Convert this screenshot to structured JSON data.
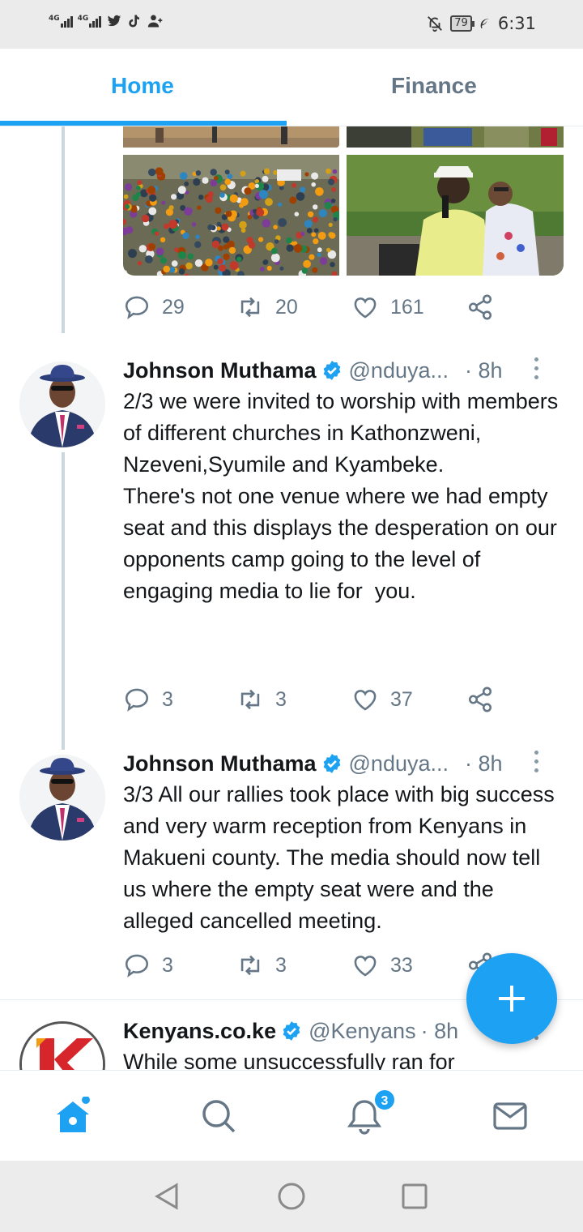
{
  "status_bar": {
    "network_1": "4G",
    "network_2": "4G",
    "battery": "79",
    "time": "6:31",
    "icons": [
      "signal-icon",
      "signal-icon",
      "twitter-bird-icon",
      "tiktok-icon",
      "add-person-icon",
      "bell-muted-icon",
      "battery-icon",
      "leaf-icon"
    ]
  },
  "tabs": {
    "home": "Home",
    "finance": "Finance"
  },
  "previous_tweet": {
    "replies": "29",
    "retweets": "20",
    "likes": "161"
  },
  "tweets": [
    {
      "name": "Johnson Muthama",
      "handle": "@nduya...",
      "time": "· 8h",
      "text": "2/3 we were invited to worship with members of different churches in Kathonzweni, Nzeveni,Syumile and Kyambeke.\nThere's not one venue where we had empty seat and this displays the desperation on our opponents camp going to the level of engaging media to lie for  you.",
      "replies": "3",
      "retweets": "3",
      "likes": "37"
    },
    {
      "name": "Johnson Muthama",
      "handle": "@nduya...",
      "time": "· 8h",
      "text": "3/3 All our rallies took place with big success and very warm reception from Kenyans in Makueni county. The media should now tell us where the empty seat were and the alleged cancelled meeting.",
      "replies": "3",
      "retweets": "3",
      "likes": "33"
    },
    {
      "name": "Kenyans.co.ke",
      "handle": "@Kenyans",
      "time": "· 8h",
      "text": "While some unsuccessfully ran for"
    }
  ],
  "bottom_nav": {
    "notifications_badge": "3",
    "items": [
      "home-icon",
      "search-icon",
      "notifications-icon",
      "messages-icon"
    ]
  },
  "colors": {
    "accent": "#1da1f2",
    "secondary_text": "#657786",
    "primary_text": "#14171a"
  }
}
